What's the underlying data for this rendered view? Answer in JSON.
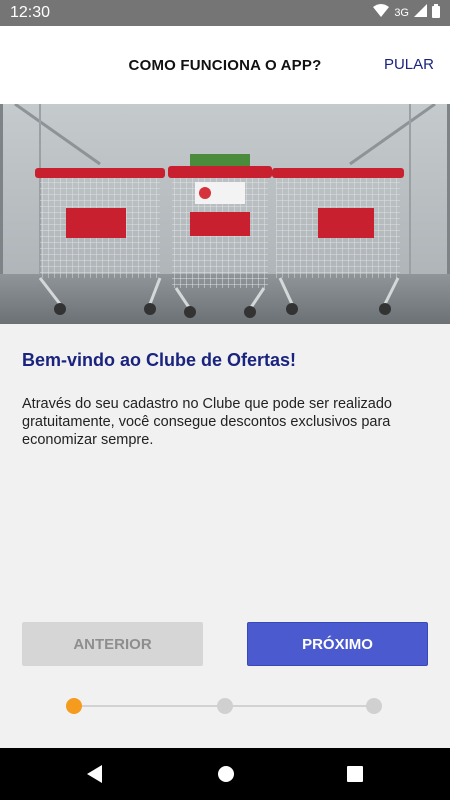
{
  "status_bar": {
    "time": "12:30",
    "network": "3G",
    "icons": [
      "wifi-icon",
      "signal-icon",
      "battery-icon"
    ]
  },
  "header": {
    "title": "COMO FUNCIONA O APP?",
    "skip_label": "PULAR"
  },
  "hero": {
    "image": "shopping-carts-photo"
  },
  "content": {
    "title": "Bem-vindo ao Clube de Ofertas!",
    "body": "Através do seu cadastro no Clube que pode ser realizado gratuitamente, você consegue descontos exclusivos para economizar sempre."
  },
  "buttons": {
    "previous_label": "ANTERIOR",
    "next_label": "PRÓXIMO"
  },
  "stepper": {
    "steps": 3,
    "current": 1
  },
  "colors": {
    "primary": "#1a237e",
    "button_next": "#4b5bcf",
    "button_prev": "#d6d6d6",
    "active_step": "#f59b1d",
    "status_bar": "#757575"
  },
  "nav_bar": {
    "icons": [
      "back-icon",
      "home-icon",
      "recents-icon"
    ]
  }
}
